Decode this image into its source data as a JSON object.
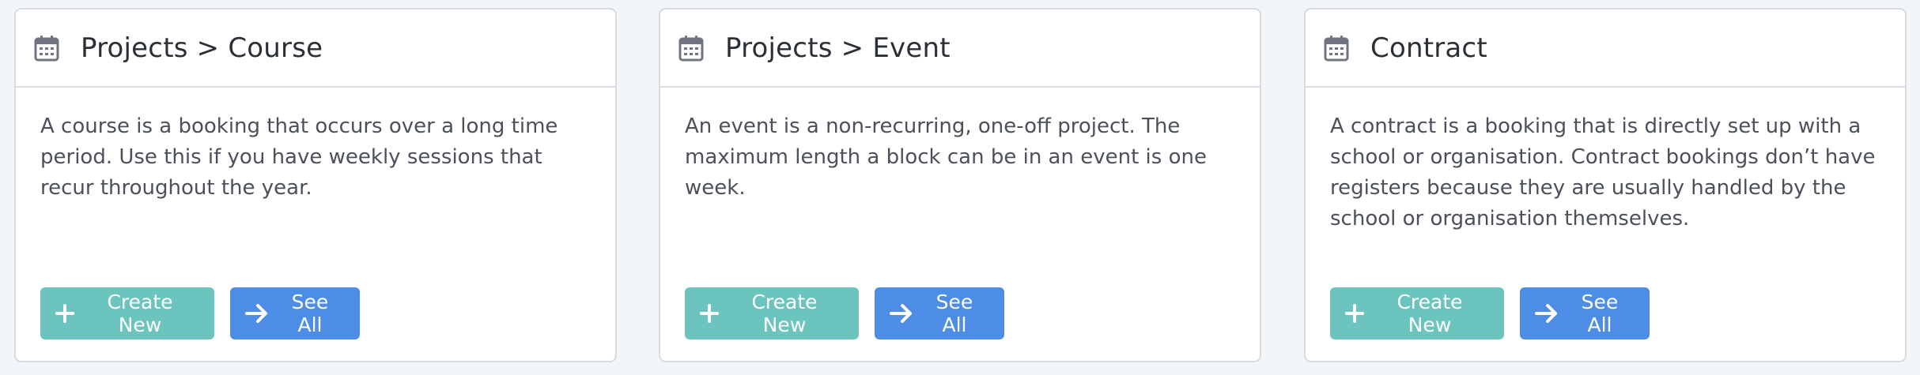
{
  "cards": [
    {
      "title": "Projects > Course",
      "description": "A course is a booking that occurs over a long time period. Use this if you have weekly sessions that recur throughout the year.",
      "create_label": "Create New",
      "see_all_label": "See All",
      "icon": "calendar-icon"
    },
    {
      "title": "Projects > Event",
      "description": "An event is a non-recurring, one-off project. The maximum length a block can be in an event is one week.",
      "create_label": "Create New",
      "see_all_label": "See All",
      "icon": "calendar-icon"
    },
    {
      "title": "Contract",
      "description": "A contract is a booking that is directly set up with a school or organisation. Contract bookings don’t have registers because they are usually handled by the school or organisation themselves.",
      "create_label": "Create New",
      "see_all_label": "See All",
      "icon": "calendar-icon"
    }
  ],
  "colors": {
    "create_button": "#6bc4bd",
    "see_all_button": "#4d8de6",
    "icon": "#6f7480",
    "background": "#f3f6f9"
  }
}
